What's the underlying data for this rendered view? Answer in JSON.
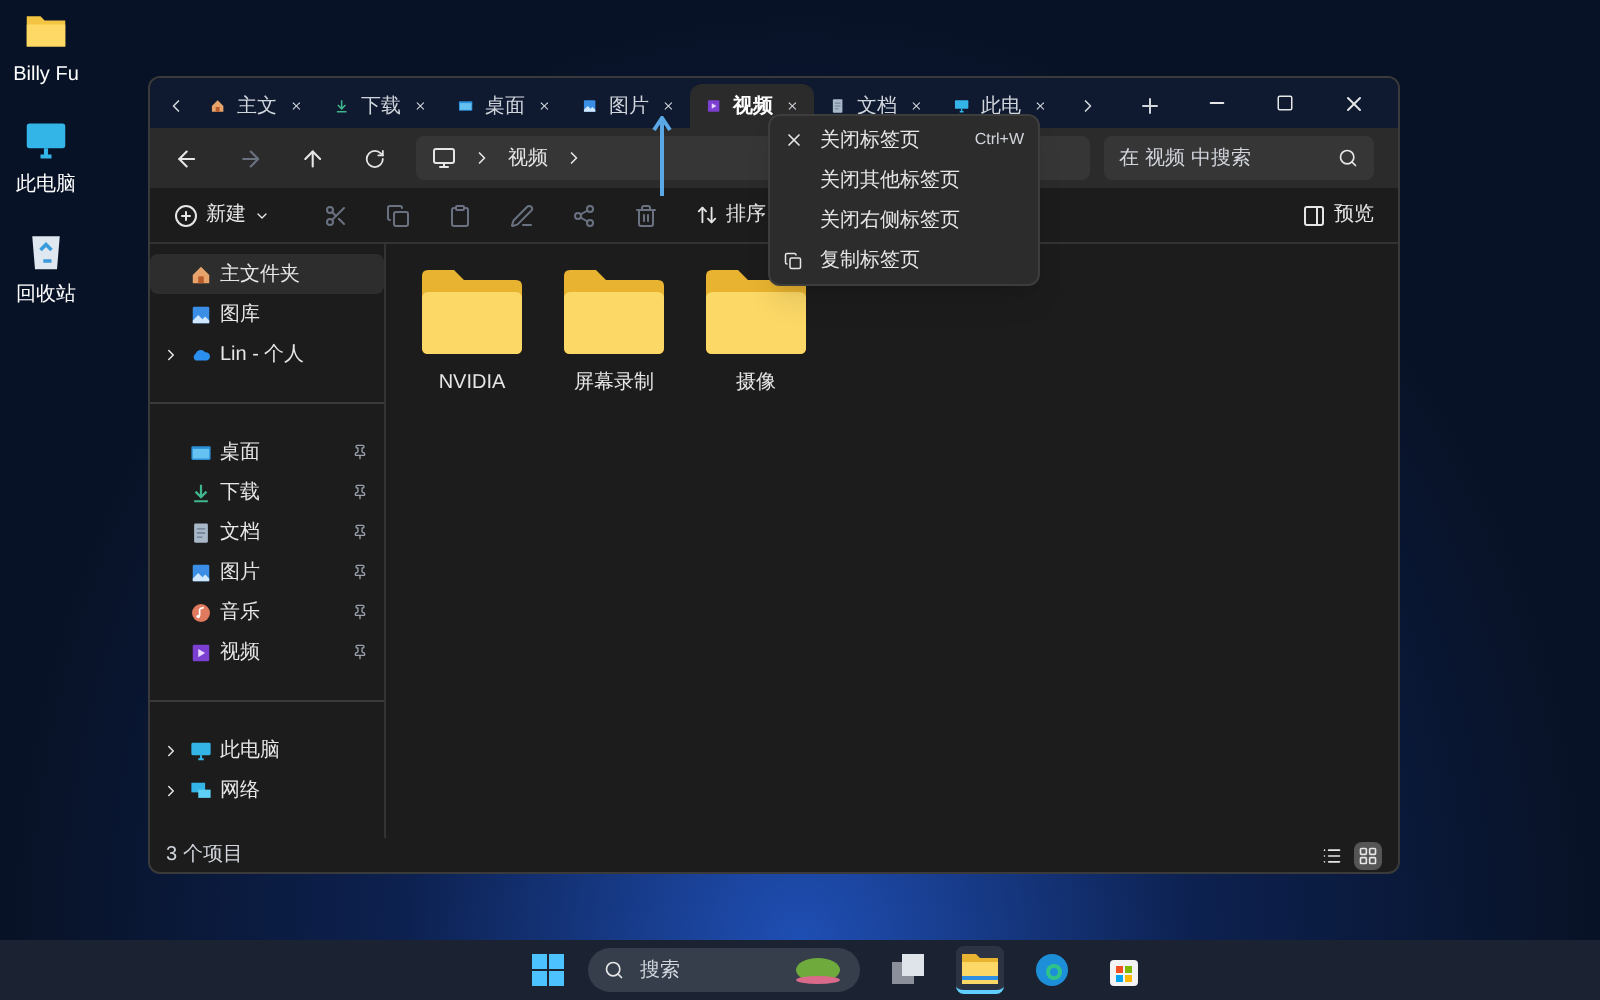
{
  "desktop_icons": [
    {
      "label": "Billy Fu",
      "kind": "folder"
    },
    {
      "label": "此电脑",
      "kind": "pc"
    },
    {
      "label": "回收站",
      "kind": "bin"
    }
  ],
  "tabs": [
    {
      "label": "主文",
      "kind": "home",
      "selected": false
    },
    {
      "label": "下载",
      "kind": "download",
      "selected": false
    },
    {
      "label": "桌面",
      "kind": "desktop",
      "selected": false
    },
    {
      "label": "图片",
      "kind": "pictures",
      "selected": false
    },
    {
      "label": "视频",
      "kind": "videos",
      "selected": true
    },
    {
      "label": "文档",
      "kind": "documents",
      "selected": false
    },
    {
      "label": "此电",
      "kind": "pc",
      "selected": false
    }
  ],
  "address": {
    "crumbs": [
      "视频"
    ]
  },
  "search": {
    "placeholder": "在 视频 中搜索"
  },
  "toolbar": {
    "new": "新建",
    "sort": "排序",
    "preview": "预览"
  },
  "sidebar": {
    "groups": [
      [
        {
          "label": "主文件夹",
          "kind": "home",
          "expandable": false,
          "pinned": false,
          "selected": true
        },
        {
          "label": "图库",
          "kind": "pictures",
          "expandable": false,
          "pinned": false,
          "selected": false
        },
        {
          "label": "Lin - 个人",
          "kind": "cloud",
          "expandable": true,
          "pinned": false,
          "selected": false
        }
      ],
      [
        {
          "label": "桌面",
          "kind": "desktop",
          "expandable": false,
          "pinned": true,
          "selected": false
        },
        {
          "label": "下载",
          "kind": "download",
          "expandable": false,
          "pinned": true,
          "selected": false
        },
        {
          "label": "文档",
          "kind": "documents",
          "expandable": false,
          "pinned": true,
          "selected": false
        },
        {
          "label": "图片",
          "kind": "pictures",
          "expandable": false,
          "pinned": true,
          "selected": false
        },
        {
          "label": "音乐",
          "kind": "music",
          "expandable": false,
          "pinned": true,
          "selected": false
        },
        {
          "label": "视频",
          "kind": "videos",
          "expandable": false,
          "pinned": true,
          "selected": false
        }
      ],
      [
        {
          "label": "此电脑",
          "kind": "pc",
          "expandable": true,
          "pinned": false,
          "selected": false
        },
        {
          "label": "网络",
          "kind": "network",
          "expandable": true,
          "pinned": false,
          "selected": false
        }
      ]
    ]
  },
  "files": [
    {
      "name": "NVIDIA"
    },
    {
      "name": "屏幕录制"
    },
    {
      "name": "摄像"
    }
  ],
  "status_bar": {
    "count": "3 个项目"
  },
  "view_buttons": [
    {
      "kind": "details",
      "selected": false
    },
    {
      "kind": "tiles",
      "selected": true
    }
  ],
  "context_menu": {
    "items": [
      {
        "label": "关闭标签页",
        "shortcut": "Ctrl+W",
        "kind": "close"
      },
      {
        "label": "关闭其他标签页",
        "kind": "plain"
      },
      {
        "label": "关闭右侧标签页",
        "kind": "plain"
      },
      {
        "label": "复制标签页",
        "kind": "duplicate"
      }
    ]
  },
  "taskbar": {
    "search_placeholder": "搜索",
    "apps": [
      {
        "kind": "taskview",
        "selected": false
      },
      {
        "kind": "explorer",
        "selected": true
      },
      {
        "kind": "edge",
        "selected": false
      },
      {
        "kind": "store",
        "selected": false
      }
    ]
  }
}
